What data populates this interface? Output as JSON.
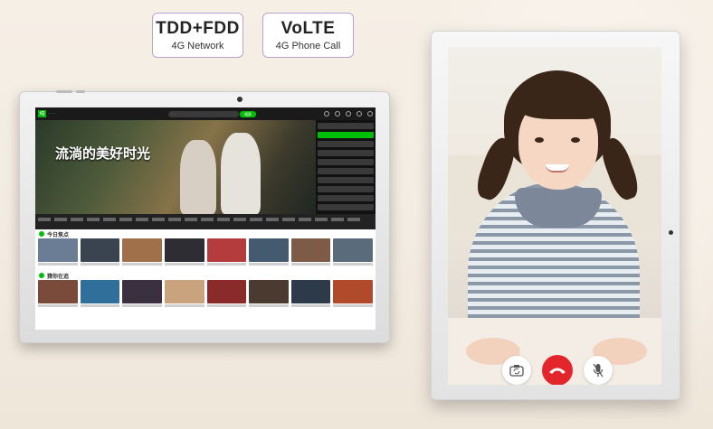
{
  "badges": [
    {
      "title": "TDD+FDD",
      "subtitle": "4G Network"
    },
    {
      "title": "VoLTE",
      "subtitle": "4G Phone Call"
    }
  ],
  "landscape_screen": {
    "search_button": "搜索",
    "hero_title": "流淌的美好时光",
    "section_today": "今日焦点",
    "section_guess": "猜你在追"
  },
  "call_controls": {
    "camera_icon": "camera-switch-icon",
    "hangup_icon": "phone-hangup-icon",
    "mute_icon": "microphone-icon",
    "hangup_color": "#e3262c"
  },
  "colors": {
    "brand_green": "#00be06",
    "badge_border": "#b7a3cf"
  }
}
